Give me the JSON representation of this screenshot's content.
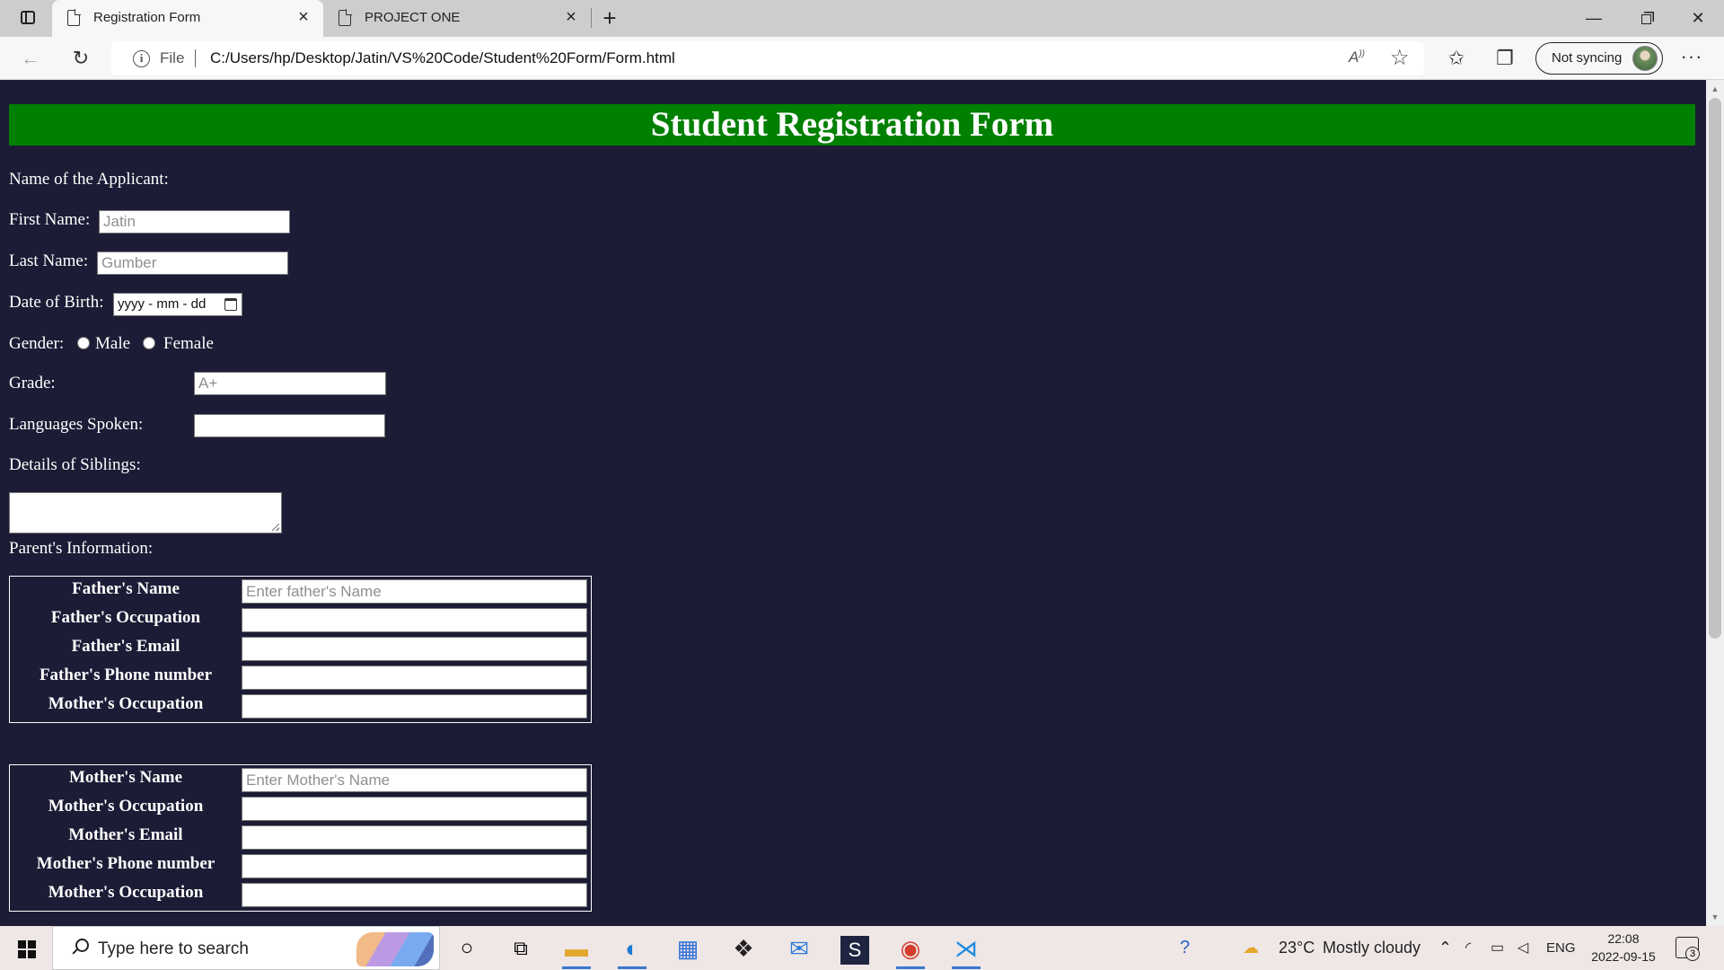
{
  "browser": {
    "tabs": [
      {
        "title": "Registration Form",
        "active": true
      },
      {
        "title": "PROJECT ONE",
        "active": false
      }
    ],
    "address": {
      "scheme": "File",
      "url": "C:/Users/hp/Desktop/Jatin/VS%20Code/Student%20Form/Form.html"
    },
    "sync_label": "Not syncing"
  },
  "form": {
    "title": "Student Registration Form",
    "applicant_label": "Name of the Applicant:",
    "first_name": {
      "label": "First Name:",
      "placeholder": "Jatin",
      "value": ""
    },
    "last_name": {
      "label": "Last Name:",
      "placeholder": "Gumber",
      "value": ""
    },
    "dob": {
      "label": "Date of Birth:",
      "display": "yyyy - mm - dd"
    },
    "gender": {
      "label": "Gender:",
      "options": [
        "Male",
        "Female"
      ],
      "selected": null
    },
    "grade": {
      "label": "Grade:",
      "placeholder": "A+",
      "value": ""
    },
    "languages": {
      "label": "Languages Spoken:",
      "value": ""
    },
    "siblings": {
      "label": "Details of Siblings:",
      "value": ""
    },
    "parents_label": "Parent's Information:",
    "father_table": [
      {
        "label": "Father's Name",
        "placeholder": "Enter father's Name"
      },
      {
        "label": "Father's Occupation",
        "placeholder": ""
      },
      {
        "label": "Father's Email",
        "placeholder": ""
      },
      {
        "label": "Father's Phone number",
        "placeholder": ""
      },
      {
        "label": "Mother's Occupation",
        "placeholder": ""
      }
    ],
    "mother_table": [
      {
        "label": "Mother's Name",
        "placeholder": "Enter Mother's Name"
      },
      {
        "label": "Mother's Occupation",
        "placeholder": ""
      },
      {
        "label": "Mother's Email",
        "placeholder": ""
      },
      {
        "label": "Mother's Phone number",
        "placeholder": ""
      },
      {
        "label": "Mother's Occupation",
        "placeholder": ""
      }
    ]
  },
  "taskbar": {
    "search_placeholder": "Type here to search",
    "weather": {
      "temp": "23°C",
      "condition": "Mostly cloudy"
    },
    "language": "ENG",
    "time": "22:08",
    "date": "2022-09-15",
    "notification_count": "3"
  },
  "colors": {
    "page_background": "#1c1c36",
    "banner": "#008000",
    "taskbar": "#efe6e6"
  }
}
